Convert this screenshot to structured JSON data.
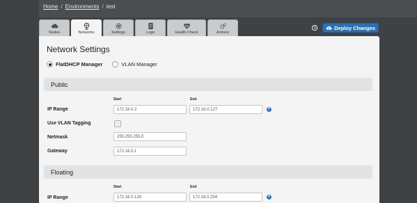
{
  "breadcrumb": {
    "home": "Home",
    "sep": "/",
    "environments": "Environments",
    "current": "test"
  },
  "tabs": [
    {
      "label": "Nodes",
      "icon": "cloud-icon"
    },
    {
      "label": "Networks",
      "icon": "network-globe-icon"
    },
    {
      "label": "Settings",
      "icon": "gear-icon"
    },
    {
      "label": "Logs",
      "icon": "document-icon"
    },
    {
      "label": "Health Check",
      "icon": "heart-monitor-icon"
    },
    {
      "label": "Actions",
      "icon": "gears-icon"
    }
  ],
  "active_tab": "Networks",
  "deploy": {
    "label": "Deploy Changes",
    "icon": "cloud-upload-icon"
  },
  "page": {
    "title": "Network Settings",
    "manager": {
      "option1": "FlatDHCP Manager",
      "option2": "VLAN Manager",
      "selected": "FlatDHCP Manager"
    }
  },
  "public": {
    "title": "Public",
    "start_label": "Start",
    "end_label": "End",
    "ip_range_label": "IP Range",
    "ip_start": "172.16.0.2",
    "ip_end": "172.16.0.127",
    "vlan_label": "Use VLAN Tagging",
    "vlan_checked": false,
    "netmask_label": "Netmask",
    "netmask": "255.255.255.0",
    "gateway_label": "Gateway",
    "gateway": "172.16.0.1"
  },
  "floating": {
    "title": "Floating",
    "start_label": "Start",
    "end_label": "End",
    "ip_range_label": "IP Range",
    "ip_start": "172.16.0.128",
    "ip_end": "172.16.0.254"
  },
  "colors": {
    "accent": "#2b6fb6",
    "plus": "#2a7cc7",
    "background": "#3f4244",
    "panel": "#f4f4f4",
    "section": "#e1e2e3"
  }
}
